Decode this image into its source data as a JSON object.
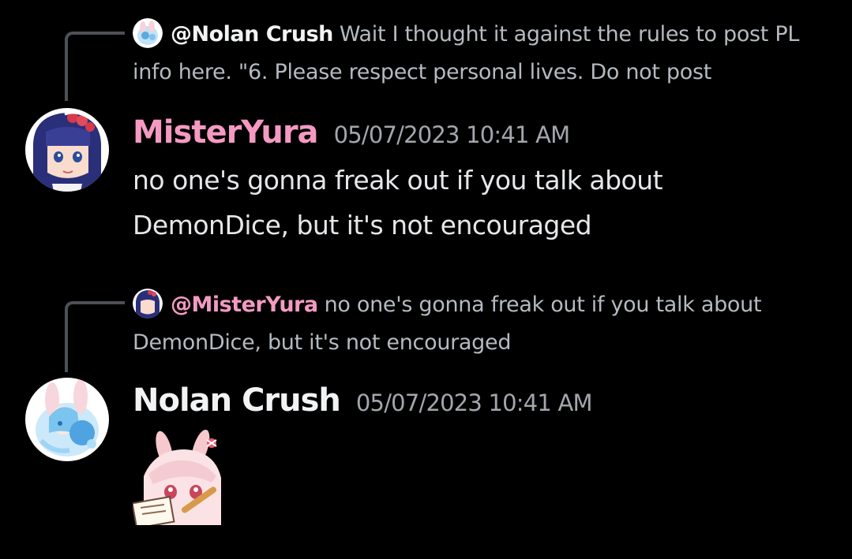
{
  "messages": [
    {
      "reply": {
        "author": "@Nolan Crush",
        "text": "Wait I thought it against the rules to post PL info here. \"6. Please respect personal lives. Do not post"
      },
      "author": "MisterYura",
      "timestamp": "05/07/2023 10:41 AM",
      "content_line1": "no one's gonna freak out if you talk about",
      "content_line2": "DemonDice, but it's not encouraged"
    },
    {
      "reply": {
        "author": "@MisterYura",
        "text": "no one's gonna freak out if you talk about DemonDice, but it's not encouraged"
      },
      "author": "Nolan Crush",
      "timestamp": "05/07/2023 10:41 AM",
      "sticker_icon": "anime-bunny-girl-writing-sticker"
    }
  ],
  "colors": {
    "background": "#000000",
    "mister_yura_name": "#f49ac2",
    "nolan_crush_name": "#f2f3f5",
    "timestamp": "#a3a6ad",
    "reply_text": "#b5bac1",
    "reply_connector": "#4e5058"
  }
}
